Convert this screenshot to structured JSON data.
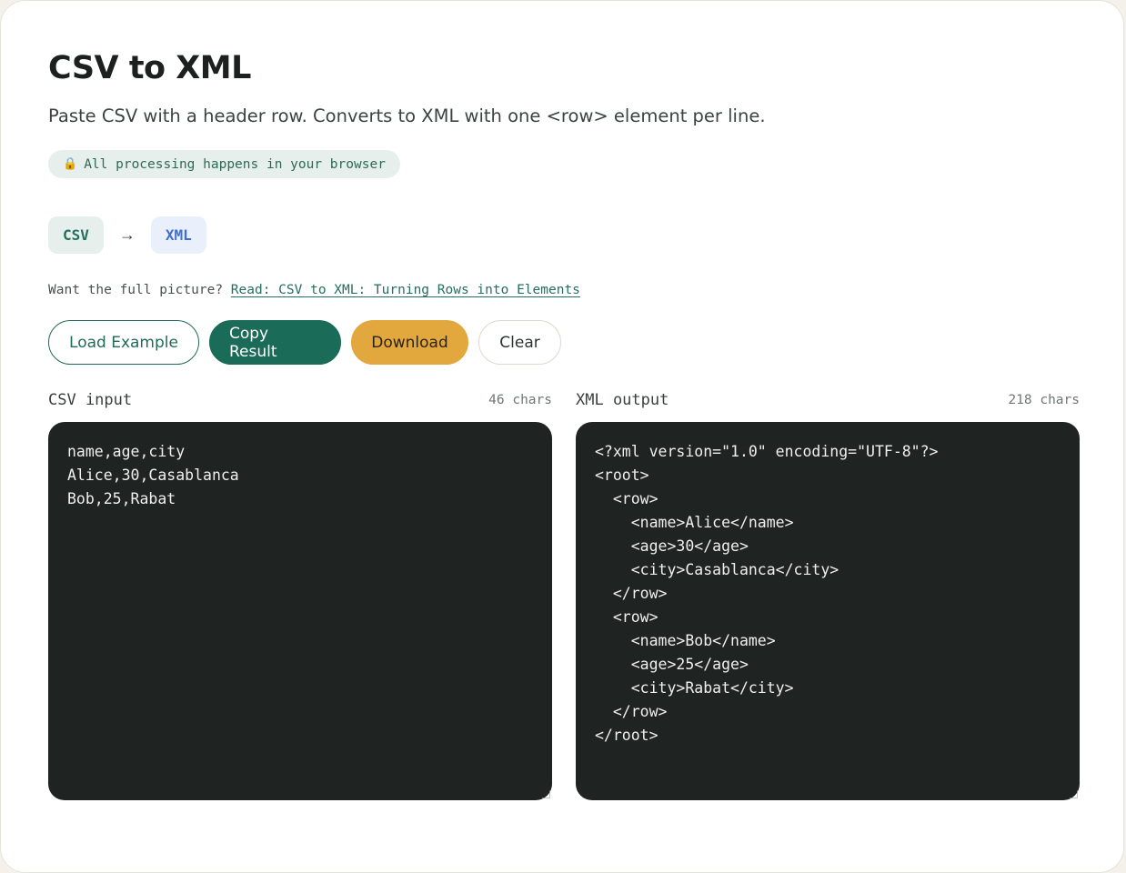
{
  "header": {
    "title": "CSV to XML",
    "subtitle": "Paste CSV with a header row. Converts to XML with one <row> element per line.",
    "privacy_icon": "lock-icon",
    "privacy_text": "All processing happens in your browser"
  },
  "formats": {
    "from": "CSV",
    "arrow": "→",
    "to": "XML"
  },
  "readmore": {
    "prefix": "Want the full picture?",
    "link_text": "Read: CSV to XML: Turning Rows into Elements"
  },
  "actions": {
    "load_example": "Load Example",
    "copy_result": "Copy Result",
    "download": "Download",
    "clear": "Clear"
  },
  "input_panel": {
    "label": "CSV input",
    "count": "46 chars",
    "content": "name,age,city\nAlice,30,Casablanca\nBob,25,Rabat"
  },
  "output_panel": {
    "label": "XML output",
    "count": "218 chars",
    "content": "<?xml version=\"1.0\" encoding=\"UTF-8\"?>\n<root>\n  <row>\n    <name>Alice</name>\n    <age>30</age>\n    <city>Casablanca</city>\n  </row>\n  <row>\n    <name>Bob</name>\n    <age>25</age>\n    <city>Rabat</city>\n  </row>\n</root>"
  },
  "colors": {
    "accent_green": "#1a6b58",
    "accent_gold": "#e2a73d",
    "code_bg": "#1f2322"
  }
}
